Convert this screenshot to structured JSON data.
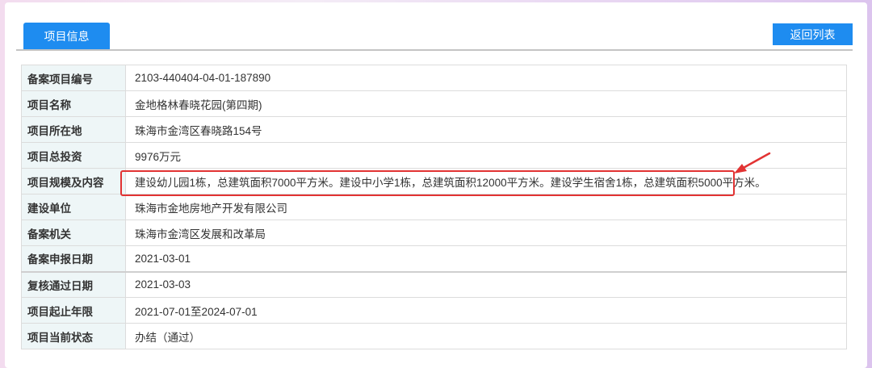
{
  "tabs": {
    "project_info": "项目信息"
  },
  "actions": {
    "back_to_list": "返回列表"
  },
  "rows": [
    {
      "label": "备案项目编号",
      "value": "2103-440404-04-01-187890"
    },
    {
      "label": "项目名称",
      "value": "金地格林春晓花园(第四期)"
    },
    {
      "label": "项目所在地",
      "value": "珠海市金湾区春晓路154号"
    },
    {
      "label": "项目总投资",
      "value": "9976万元"
    },
    {
      "label": "项目规模及内容",
      "value": "建设幼儿园1栋，总建筑面积7000平方米。建设中小学1栋，总建筑面积12000平方米。建设学生宿舍1栋，总建筑面积5000平方米。"
    },
    {
      "label": "建设单位",
      "value": "珠海市金地房地产开发有限公司"
    },
    {
      "label": "备案机关",
      "value": "珠海市金湾区发展和改革局"
    },
    {
      "label": "备案申报日期",
      "value": "2021-03-01"
    },
    {
      "label": "复核通过日期",
      "value": "2021-03-03"
    },
    {
      "label": "项目起止年限",
      "value": "2021-07-01至2024-07-01"
    },
    {
      "label": "项目当前状态",
      "value": "办结（通过）"
    }
  ],
  "colors": {
    "accent": "#1e8cf0",
    "label_bg": "#eef6f7",
    "highlight": "#e23333"
  },
  "icons": {
    "annotation": "red-arrow-icon"
  }
}
